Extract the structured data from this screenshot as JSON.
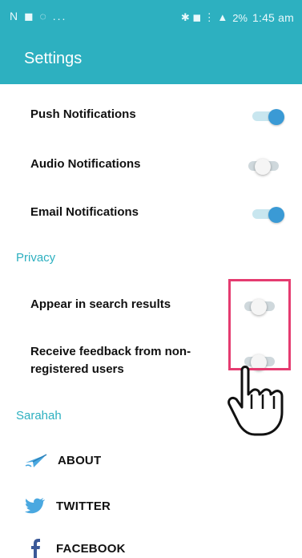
{
  "status_bar": {
    "left_icons": "N ◼ ◌ ...",
    "right_icons": "✱ ◼ ⋮ ▲",
    "battery": "2%",
    "time": "1:45 am"
  },
  "app_bar": {
    "title": "Settings"
  },
  "notifications": {
    "push": {
      "label": "Push Notifications",
      "enabled": true
    },
    "audio": {
      "label": "Audio Notifications",
      "enabled": false
    },
    "email": {
      "label": "Email Notifications",
      "enabled": true
    }
  },
  "privacy": {
    "section_title": "Privacy",
    "appear_in_search": {
      "label": "Appear in search results",
      "enabled": false
    },
    "feedback_from_non_registered": {
      "label_line1": "Receive feedback from non-",
      "label_line2": "registered users",
      "enabled": false
    }
  },
  "sarahah": {
    "section_title": "Sarahah",
    "links": [
      {
        "label": "ABOUT",
        "icon": "plane-icon"
      },
      {
        "label": "TWITTER",
        "icon": "twitter-bird-icon"
      },
      {
        "label": "FACEBOOK",
        "icon": "facebook-icon"
      }
    ]
  },
  "colors": {
    "accent": "#2db0c0",
    "toggle_on": "#3a9ad5",
    "highlight_border": "#e53b70"
  }
}
